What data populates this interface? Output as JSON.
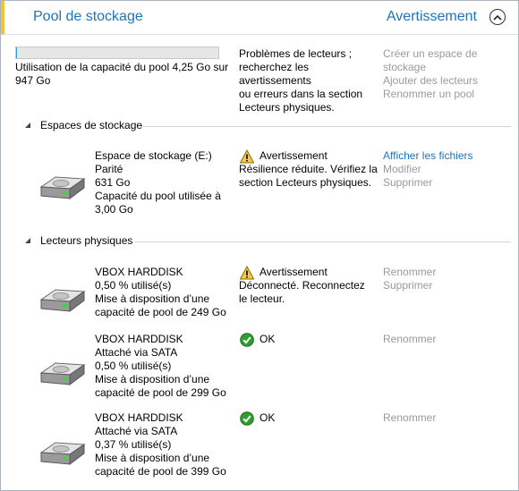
{
  "header": {
    "pool_name": "Pool de stockage",
    "status": "Avertissement"
  },
  "pool": {
    "capacity_fraction": 0.0045,
    "capacity_line1": "Utilisation de la capacité du pool 4,25 Go sur",
    "capacity_line2": "947 Go",
    "problem_lines": [
      "Problèmes de lecteurs ;",
      "recherchez les avertissements",
      "ou erreurs dans la section",
      "Lecteurs physiques."
    ],
    "actions": [
      "Créer un espace de",
      "stockage",
      "Ajouter des lecteurs",
      "Renommer un pool"
    ]
  },
  "spaces_section": {
    "title": "Espaces de stockage",
    "items": [
      {
        "lines": [
          "Espace de stockage (E:)",
          "Parité",
          "631 Go",
          "Capacité du pool utilisée à",
          "3,00 Go"
        ],
        "status_icon": "warning-icon",
        "status_title": "Avertissement",
        "status_lines": [
          "Résilience réduite. Vérifiez la",
          "section Lecteurs physiques."
        ],
        "actions": [
          "Afficher les fichiers",
          "Modifier",
          "Supprimer"
        ]
      }
    ]
  },
  "drives_section": {
    "title": "Lecteurs physiques",
    "items": [
      {
        "lines": [
          "VBOX HARDDISK",
          "0,50 % utilisé(s)",
          "Mise à disposition d’une",
          "capacité de pool de 249 Go"
        ],
        "status_icon": "warning-icon",
        "status_title": "Avertissement",
        "status_lines": [
          "Déconnecté. Reconnectez",
          "le lecteur."
        ],
        "actions": [
          "Renommer",
          "Supprimer"
        ]
      },
      {
        "lines": [
          "VBOX HARDDISK",
          "Attaché via SATA",
          "0,50 % utilisé(s)",
          "Mise à disposition d’une",
          "capacité de pool de 299 Go"
        ],
        "status_icon": "ok-check-icon",
        "status_title": "OK",
        "status_lines": [],
        "actions": [
          "Renommer"
        ]
      },
      {
        "lines": [
          "VBOX HARDDISK",
          "Attaché via SATA",
          "0,37 % utilisé(s)",
          "Mise à disposition d’une",
          "capacité de pool de 399 Go"
        ],
        "status_icon": "ok-check-icon",
        "status_title": "OK",
        "status_lines": [],
        "actions": [
          "Renommer"
        ]
      }
    ]
  },
  "colors": {
    "accent": "#f1c232",
    "link": "#1e73be",
    "disabled_link": "#9a9a9a",
    "ok_green": "#2e9e2e",
    "warning_yellow": "#f7c948"
  }
}
